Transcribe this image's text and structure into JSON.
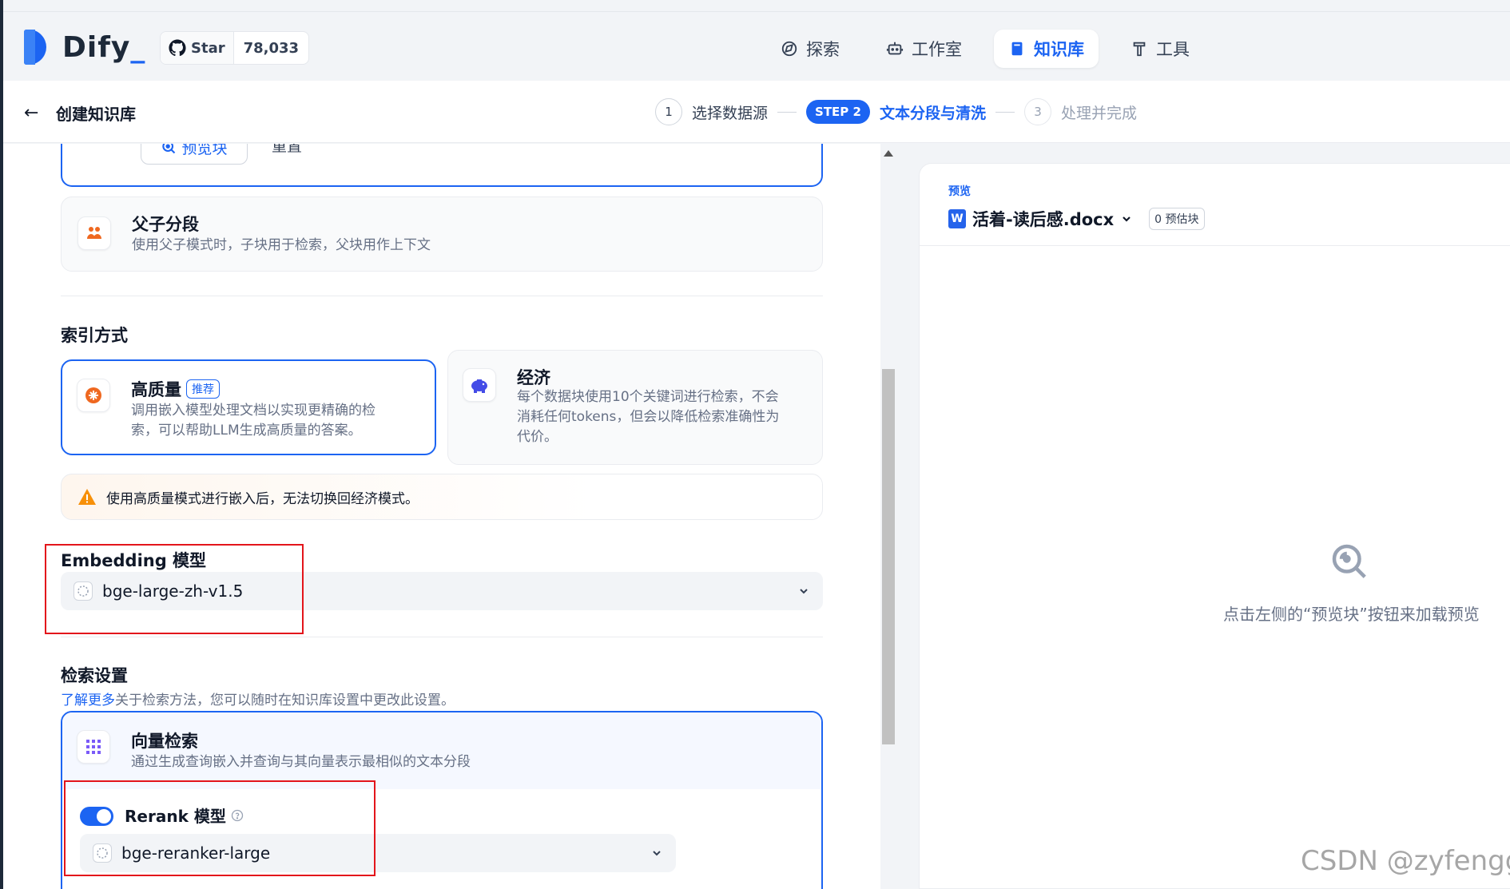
{
  "header": {
    "logo_text": "Dify",
    "github": {
      "star_label": "Star",
      "count": "78,033"
    },
    "nav": [
      {
        "label": "探索",
        "icon": "compass-icon",
        "active": false
      },
      {
        "label": "工作室",
        "icon": "robot-icon",
        "active": false
      },
      {
        "label": "知识库",
        "icon": "book-icon",
        "active": true
      },
      {
        "label": "工具",
        "icon": "hammer-icon",
        "active": false
      }
    ]
  },
  "subheader": {
    "back_icon": "arrow-left-icon",
    "title": "创建知识库",
    "steps": [
      {
        "num": "1",
        "label": "选择数据源",
        "state": "done"
      },
      {
        "num": "STEP 2",
        "label": "文本分段与清洗",
        "state": "active"
      },
      {
        "num": "3",
        "label": "处理并完成",
        "state": "pending"
      }
    ]
  },
  "segment": {
    "preview_button": "预览块",
    "reset_button": "重置",
    "parent_child": {
      "title": "父子分段",
      "desc": "使用父子模式时，子块用于检索，父块用作上下文"
    }
  },
  "index": {
    "title": "索引方式",
    "high_quality": {
      "title": "高质量",
      "badge": "推荐",
      "desc_line1": "调用嵌入模型处理文档以实现更精确的检",
      "desc_line2": "索，可以帮助LLM生成高质量的答案。"
    },
    "economy": {
      "title": "经济",
      "desc_line1": "每个数据块使用10个关键词进行检索，不会",
      "desc_line2": "消耗任何tokens，但会以降低检索准确性为",
      "desc_line3": "代价。"
    },
    "warning": "使用高质量模式进行嵌入后，无法切换回经济模式。"
  },
  "embedding": {
    "title": "Embedding 模型",
    "model": "bge-large-zh-v1.5"
  },
  "retrieval": {
    "title": "检索设置",
    "learn_more": "了解更多",
    "desc": "关于检索方法，您可以随时在知识库设置中更改此设置。",
    "vector": {
      "title": "向量检索",
      "desc": "通过生成查询嵌入并查询与其向量表示最相似的文本分段"
    },
    "rerank": {
      "label": "Rerank 模型",
      "enabled": true,
      "model": "bge-reranker-large"
    }
  },
  "preview": {
    "label": "预览",
    "doc_name": "活着-读后感.docx",
    "chunk_count": "0 预估块",
    "empty_text": "点击左侧的“预览块”按钮来加载预览"
  },
  "watermark": "CSDN @zyfengg",
  "colors": {
    "accent": "#1c64f2",
    "highlight_box": "#e3151b"
  }
}
